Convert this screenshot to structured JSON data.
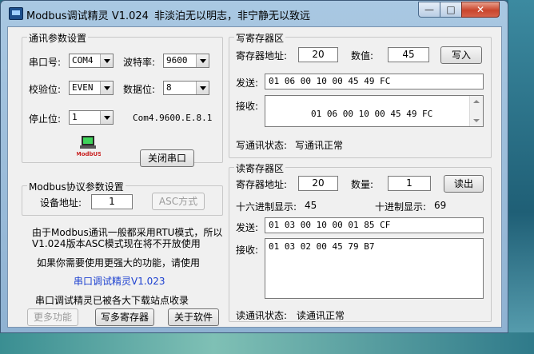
{
  "window": {
    "title": "Modbus调试精灵 V1.024",
    "motto": "非淡泊无以明志，非宁静无以致远",
    "min_glyph": "—",
    "max_glyph": "□",
    "close_glyph": "✕"
  },
  "comm": {
    "group_title": "通讯参数设置",
    "port_label": "串口号:",
    "port_value": "COM4",
    "baud_label": "波特率:",
    "baud_value": "9600",
    "parity_label": "校验位:",
    "parity_value": "EVEN",
    "databits_label": "数据位:",
    "databits_value": "8",
    "stopbits_label": "停止位:",
    "stopbits_value": "1",
    "summary": "Com4.9600.E.8.1",
    "logo_text": "ModbUS",
    "close_port_button": "关闭串口"
  },
  "protocol": {
    "group_title": "Modbus协议参数设置",
    "device_addr_label": "设备地址:",
    "device_addr_value": "1",
    "asc_button": "ASC方式"
  },
  "info": {
    "line1": "由于Modbus通讯一般都采用RTU模式，所以",
    "line2": "V1.024版本ASC模式现在将不开放使用",
    "line3": "如果你需要使用更强大的功能，请使用",
    "link": "串口调试精灵V1.023",
    "line4": "串口调试精灵已被各大下载站点收录"
  },
  "bottom_buttons": {
    "more": "更多功能",
    "write_multi": "写多寄存器",
    "about": "关于软件"
  },
  "write": {
    "group_title": "写寄存器区",
    "addr_label": "寄存器地址:",
    "addr_value": "20",
    "value_label": "数值:",
    "value_value": "45",
    "write_button": "写入",
    "send_label": "发送:",
    "send_value": "01 06 00 10 00 45 49 FC",
    "recv_label": "接收:",
    "recv_value": "01 06 00 10 00 45 49 FC",
    "status_label": "写通讯状态:",
    "status_value": "写通讯正常"
  },
  "read": {
    "group_title": "读寄存器区",
    "addr_label": "寄存器地址:",
    "addr_value": "20",
    "count_label": "数量:",
    "count_value": "1",
    "read_button": "读出",
    "hex_label": "十六进制显示:",
    "hex_value": "45",
    "dec_label": "十进制显示:",
    "dec_value": "69",
    "send_label": "发送:",
    "send_value": "01 03 00 10 00 01 85 CF",
    "recv_label": "接收:",
    "recv_value": "01 03 02 00 45 79 B7",
    "status_label": "读通讯状态:",
    "status_value": "读通讯正常"
  }
}
